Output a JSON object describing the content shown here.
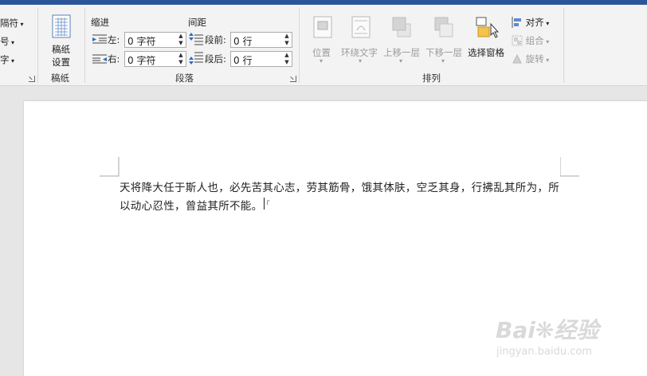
{
  "ribbon": {
    "left_partial": {
      "item1": "隔符",
      "item2": "号",
      "item3": "字"
    },
    "manuscript": {
      "button_label_line1": "稿纸",
      "button_label_line2": "设置",
      "group_label": "稿纸"
    },
    "paragraph": {
      "indent_header": "缩进",
      "spacing_header": "间距",
      "left_label": "左:",
      "right_label": "右:",
      "before_label": "段前:",
      "after_label": "段后:",
      "left_value": "0 字符",
      "right_value": "0 字符",
      "before_value": "0 行",
      "after_value": "0 行",
      "group_label": "段落"
    },
    "arrange": {
      "position_label": "位置",
      "wrap_text_label": "环绕文字",
      "bring_forward_label": "上移一层",
      "send_backward_label": "下移一层",
      "selection_pane_label": "选择窗格",
      "align_label": "对齐",
      "group_label_btn": "组合",
      "rotate_label": "旋转",
      "group_label": "排列"
    }
  },
  "document": {
    "line1": "天将降大任于斯人也，必先苦其心志，劳其筋骨，饿其体肤，空乏其身，行拂乱其所为，所",
    "line2": "以动心忍性，曾益其所不能。"
  },
  "watermark": {
    "brand": "Bai",
    "brand_suffix": "经验",
    "url": "jingyan.baidu.com"
  }
}
